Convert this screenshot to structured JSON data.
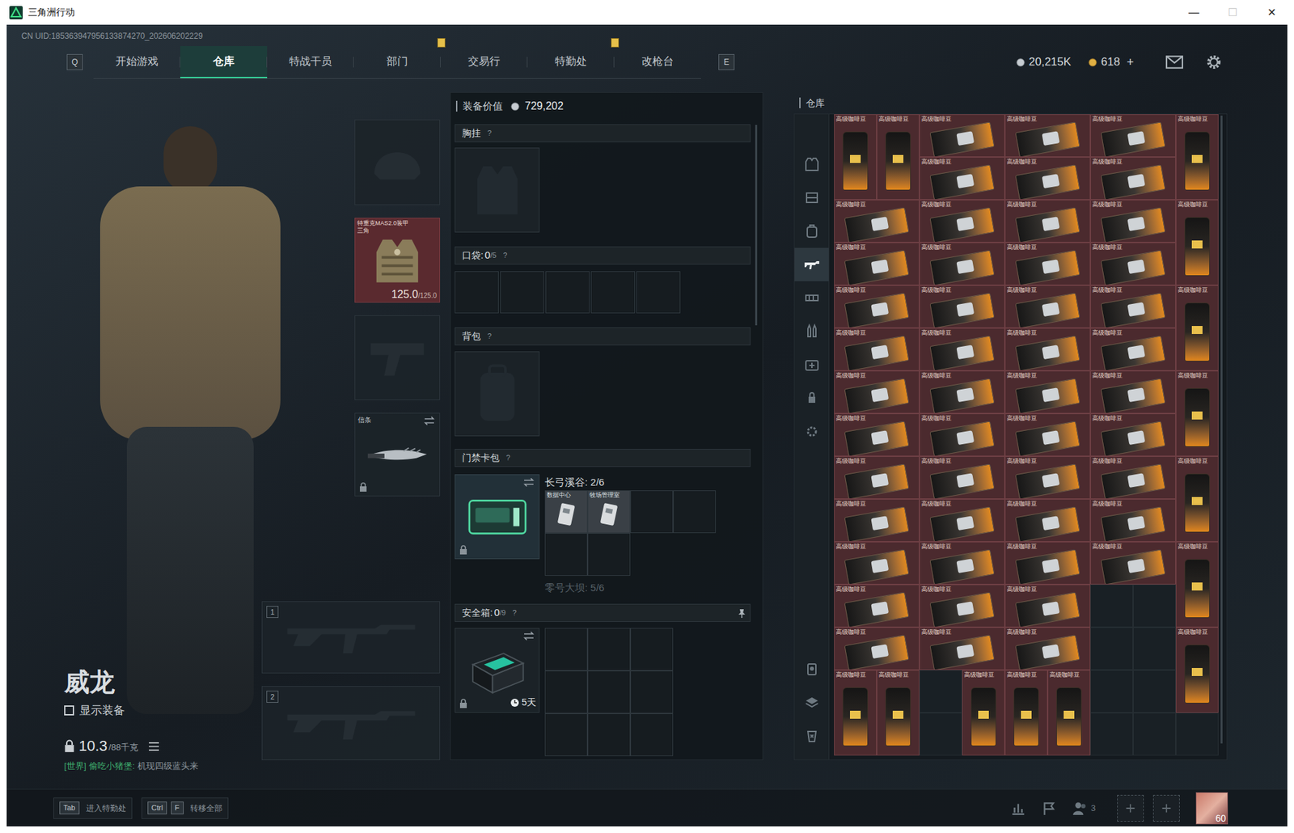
{
  "window": {
    "title": "三角洲行动",
    "controls": [
      {
        "glyph": "—",
        "disabled": false
      },
      {
        "glyph": "☐",
        "disabled": true
      },
      {
        "glyph": "✕",
        "disabled": false
      }
    ]
  },
  "uid": "CN UID:185363947956133874270_202606202229",
  "nav": {
    "prev_key": "Q",
    "next_key": "E",
    "tabs": [
      {
        "label": "开始游戏",
        "selected": false,
        "alert": false
      },
      {
        "label": "仓库",
        "selected": true,
        "alert": false
      },
      {
        "label": "特战干员",
        "selected": false,
        "alert": false
      },
      {
        "label": "部门",
        "selected": false,
        "alert": true
      },
      {
        "label": "交易行",
        "selected": false,
        "alert": false
      },
      {
        "label": "特勤处",
        "selected": false,
        "alert": true
      },
      {
        "label": "改枪台",
        "selected": false,
        "alert": false
      }
    ]
  },
  "currencies": [
    {
      "amount": "20,215K",
      "kind": "silver"
    },
    {
      "amount": "618",
      "kind": "gold"
    }
  ],
  "currency_add": "+",
  "character": {
    "name": "威龙",
    "show_equipment": {
      "label": "显示装备",
      "checked": false
    },
    "weight": "10.3",
    "weight_max": "/88千克"
  },
  "chat": {
    "channel": "[世界]",
    "sender": "偷吃小猪堡:",
    "text": "机现四级蓝头来"
  },
  "equipment": {
    "helmet": {
      "empty": true
    },
    "armor": {
      "name": "特重克MAS2.0装甲",
      "sub": "三角",
      "durability": "125.0",
      "max": "/125.0"
    },
    "pistol": {
      "empty": true
    },
    "melee": {
      "name": "信条",
      "locked": true
    },
    "weapon_slots": [
      {
        "number": "1",
        "empty": true
      },
      {
        "number": "2",
        "empty": true
      }
    ]
  },
  "loadout": {
    "value_label": "装备价值",
    "value": "729,202",
    "chest_rig": {
      "title": "胸挂",
      "help": "?"
    },
    "pockets": {
      "title": "口袋: ",
      "count": "0",
      "capacity": "/5",
      "help": "?",
      "cells": [
        {
          "filled": false
        },
        {
          "filled": false
        },
        {
          "filled": false
        },
        {
          "filled": false
        },
        {
          "filled": false
        }
      ]
    },
    "backpack": {
      "title": "背包",
      "help": "?"
    },
    "keycard": {
      "title": "门禁卡包",
      "help": "?",
      "locked": true,
      "maps": [
        {
          "label": "长弓溪谷: 2/6",
          "dimmed": false,
          "cells": [
            {
              "filled": true,
              "label": "数据中心"
            },
            {
              "filled": true,
              "label": "牧场管理室"
            },
            {
              "filled": false
            },
            {
              "filled": false
            },
            {
              "filled": false
            },
            {
              "filled": false
            }
          ]
        },
        {
          "label": "零号大坝: 5/6",
          "dimmed": true
        }
      ]
    },
    "safe": {
      "title": "安全箱: ",
      "count": "0",
      "capacity": "/9",
      "help": "?",
      "timer": "5天",
      "locked": true,
      "cells": [
        {
          "filled": false
        },
        {
          "filled": false
        },
        {
          "filled": false
        },
        {
          "filled": false
        },
        {
          "filled": false
        },
        {
          "filled": false
        },
        {
          "filled": false
        },
        {
          "filled": false
        },
        {
          "filled": false
        }
      ]
    }
  },
  "warehouse": {
    "title": "仓库",
    "sidebar": [
      {
        "kind": "helmet",
        "selected": false
      },
      {
        "kind": "armor",
        "selected": false
      },
      {
        "kind": "rig",
        "selected": false
      },
      {
        "kind": "backpack",
        "selected": false
      },
      {
        "kind": "weapon",
        "selected": true
      },
      {
        "kind": "attachment",
        "selected": false
      },
      {
        "kind": "ammo",
        "selected": false
      },
      {
        "kind": "medical",
        "selected": false
      },
      {
        "kind": "key",
        "selected": false
      },
      {
        "kind": "misc",
        "selected": false
      }
    ],
    "sidebar_bottom": [
      {
        "kind": "collection",
        "selected": false
      },
      {
        "kind": "layers",
        "selected": false
      },
      {
        "kind": "recycle",
        "selected": false
      }
    ],
    "items": [
      {
        "label": "高级咖啡豆",
        "kind": "bag"
      },
      {
        "label": "高级咖啡豆",
        "kind": "bag"
      },
      {
        "label": "高级咖啡豆",
        "kind": "box"
      },
      {
        "label": "高级咖啡豆",
        "kind": "box"
      },
      {
        "label": "高级咖啡豆",
        "kind": "box"
      },
      {
        "label": "高级咖啡豆",
        "kind": "bag"
      },
      {
        "label": "高级咖啡豆",
        "kind": "box"
      },
      {
        "label": "高级咖啡豆",
        "kind": "box"
      },
      {
        "label": "高级咖啡豆",
        "kind": "box"
      },
      {
        "label": "高级咖啡豆",
        "kind": "box"
      },
      {
        "label": "高级咖啡豆",
        "kind": "box"
      },
      {
        "label": "高级咖啡豆",
        "kind": "box"
      },
      {
        "label": "高级咖啡豆",
        "kind": "box"
      },
      {
        "label": "高级咖啡豆",
        "kind": "bag"
      },
      {
        "label": "高级咖啡豆",
        "kind": "box"
      },
      {
        "label": "高级咖啡豆",
        "kind": "box"
      },
      {
        "label": "高级咖啡豆",
        "kind": "box"
      },
      {
        "label": "高级咖啡豆",
        "kind": "box"
      },
      {
        "label": "高级咖啡豆",
        "kind": "box"
      },
      {
        "label": "高级咖啡豆",
        "kind": "box"
      },
      {
        "label": "高级咖啡豆",
        "kind": "box"
      },
      {
        "label": "高级咖啡豆",
        "kind": "box"
      },
      {
        "label": "高级咖啡豆",
        "kind": "bag"
      },
      {
        "label": "高级咖啡豆",
        "kind": "box"
      },
      {
        "label": "高级咖啡豆",
        "kind": "box"
      },
      {
        "label": "高级咖啡豆",
        "kind": "box"
      },
      {
        "label": "高级咖啡豆",
        "kind": "box"
      },
      {
        "label": "高级咖啡豆",
        "kind": "box"
      },
      {
        "label": "高级咖啡豆",
        "kind": "box"
      },
      {
        "label": "高级咖啡豆",
        "kind": "box"
      },
      {
        "label": "高级咖啡豆",
        "kind": "box"
      },
      {
        "label": "高级咖啡豆",
        "kind": "bag"
      },
      {
        "label": "高级咖啡豆",
        "kind": "box"
      },
      {
        "label": "高级咖啡豆",
        "kind": "box"
      },
      {
        "label": "高级咖啡豆",
        "kind": "box"
      },
      {
        "label": "高级咖啡豆",
        "kind": "box"
      },
      {
        "label": "高级咖啡豆",
        "kind": "box"
      },
      {
        "label": "高级咖啡豆",
        "kind": "box"
      },
      {
        "label": "高级咖啡豆",
        "kind": "box"
      },
      {
        "label": "高级咖啡豆",
        "kind": "box"
      },
      {
        "label": "高级咖啡豆",
        "kind": "bag"
      },
      {
        "label": "高级咖啡豆",
        "kind": "box"
      },
      {
        "label": "高级咖啡豆",
        "kind": "box"
      },
      {
        "label": "高级咖啡豆",
        "kind": "box"
      },
      {
        "label": "高级咖啡豆",
        "kind": "box"
      },
      {
        "label": "高级咖啡豆",
        "kind": "box"
      },
      {
        "label": "高级咖啡豆",
        "kind": "box"
      },
      {
        "label": "高级咖啡豆",
        "kind": "box"
      },
      {
        "label": "高级咖啡豆",
        "kind": "box"
      },
      {
        "label": "高级咖啡豆",
        "kind": "bag"
      },
      {
        "label": "高级咖啡豆",
        "kind": "box"
      },
      {
        "label": "高级咖啡豆",
        "kind": "box"
      },
      {
        "label": "高级咖啡豆",
        "kind": "box"
      },
      {
        "label": "高级咖啡豆",
        "kind": "box"
      },
      {
        "label": "高级咖啡豆",
        "kind": "box"
      },
      {
        "label": "高级咖啡豆",
        "kind": "box"
      },
      {
        "label": "高级咖啡豆",
        "kind": "bag"
      },
      {
        "label": "高级咖啡豆",
        "kind": "bag"
      },
      {
        "label": "高级咖啡豆",
        "kind": "bag"
      },
      {
        "label": "高级咖啡豆",
        "kind": "bag"
      },
      {
        "label": "高级咖啡豆",
        "kind": "bag"
      },
      {
        "label": "高级咖啡豆",
        "kind": "bag"
      }
    ]
  },
  "hotkeys": [
    {
      "keys": [
        "Tab"
      ],
      "label": "进入特勤处"
    },
    {
      "keys": [
        "Ctrl",
        "F"
      ],
      "label": "转移全部"
    }
  ],
  "squad": {
    "count": "3",
    "slots": [
      {
        "empty": true
      },
      {
        "empty": true
      }
    ],
    "level": "60"
  }
}
